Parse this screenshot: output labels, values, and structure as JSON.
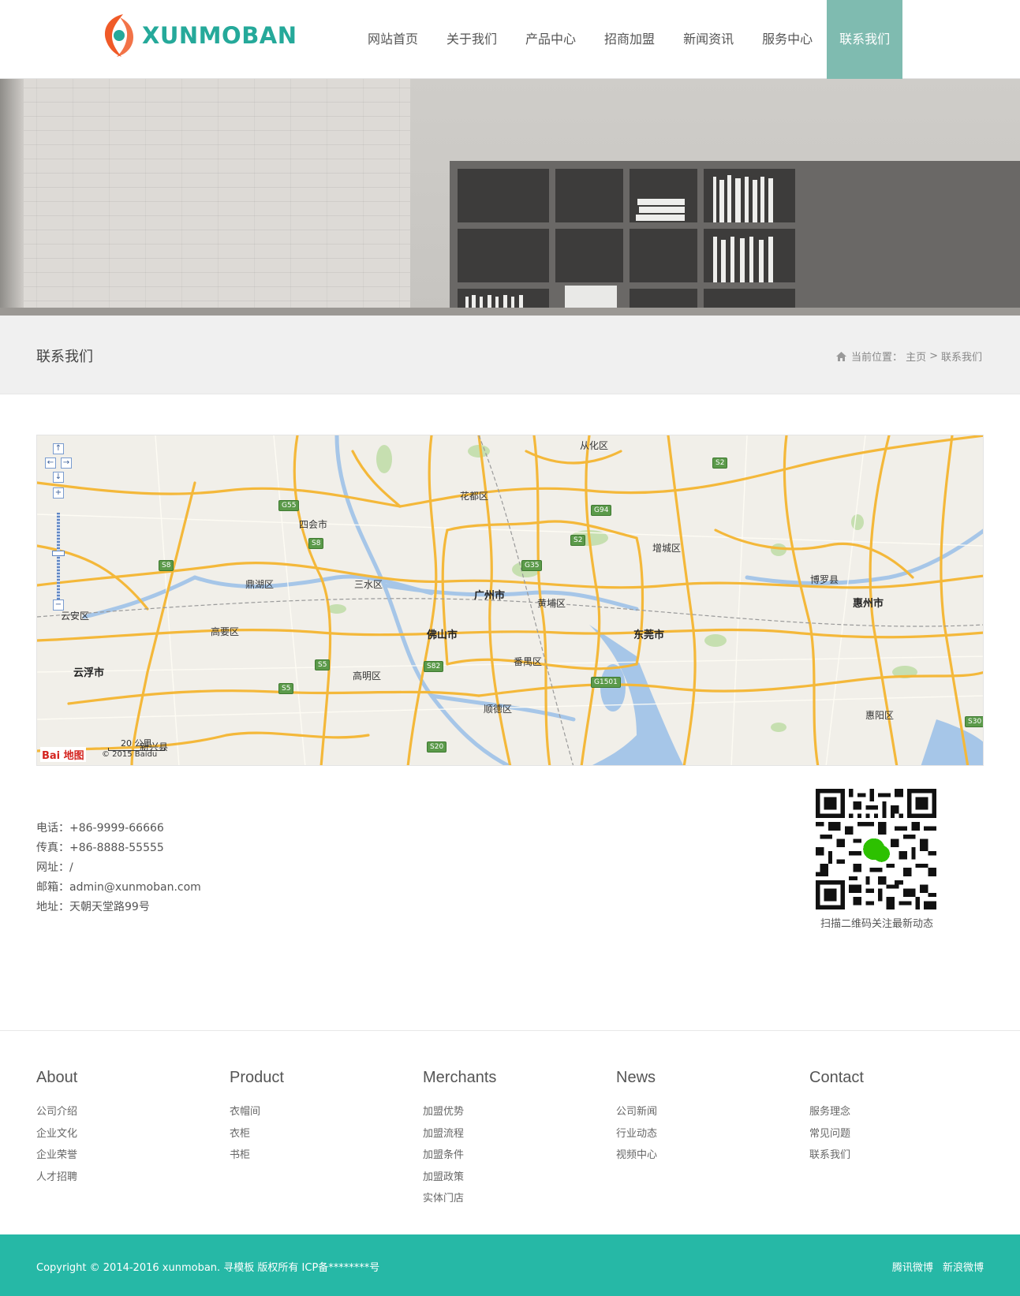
{
  "brand": {
    "logo_text": "XUNMOBAN",
    "accent": "#25a99a",
    "logo_orange": "#f05a28"
  },
  "nav": {
    "items": [
      {
        "label": "网站首页"
      },
      {
        "label": "关于我们"
      },
      {
        "label": "产品中心"
      },
      {
        "label": "招商加盟"
      },
      {
        "label": "新闻资讯"
      },
      {
        "label": "服务中心"
      },
      {
        "label": "联系我们"
      }
    ],
    "active_index": 6,
    "active_color": "#7fbbb0"
  },
  "page": {
    "title": "联系我们",
    "breadcrumb": {
      "prefix": "当前位置：",
      "home": "主页",
      "separator": ">",
      "current": "联系我们"
    }
  },
  "map": {
    "cities": [
      "广州市",
      "佛山市",
      "东莞市",
      "惠州市",
      "云浮市"
    ],
    "districts": [
      "从化区",
      "花都区",
      "四会市",
      "增城区",
      "鼎湖区",
      "三水区",
      "黄埔区",
      "博罗县",
      "云安区",
      "高要区",
      "番禺区",
      "高明区",
      "顺德区",
      "惠阳区",
      "新兴县"
    ],
    "highways": [
      "G55",
      "S8",
      "G94",
      "S2",
      "S2",
      "G35",
      "S8",
      "S5",
      "S82",
      "G1501",
      "S5",
      "S20",
      "S30"
    ],
    "scale_label": "20 公里",
    "provider_logo": "Bai 地图",
    "copyright": "© 2015 Baidu"
  },
  "contact": {
    "phone": "电话：+86-9999-66666",
    "fax": "传真：+86-8888-55555",
    "website": "网址：/",
    "email": "邮箱：admin@xunmoban.com",
    "address": "地址：天朝天堂路99号",
    "qr_caption": "扫描二维码关注最新动态"
  },
  "footer": {
    "columns": [
      {
        "title": "About",
        "links": [
          "公司介绍",
          "企业文化",
          "企业荣誉",
          "人才招聘"
        ]
      },
      {
        "title": "Product",
        "links": [
          "衣帽间",
          "衣柜",
          "书柜"
        ]
      },
      {
        "title": "Merchants",
        "links": [
          "加盟优势",
          "加盟流程",
          "加盟条件",
          "加盟政策",
          "实体门店"
        ]
      },
      {
        "title": "News",
        "links": [
          "公司新闻",
          "行业动态",
          "视频中心"
        ]
      },
      {
        "title": "Contact",
        "links": [
          "服务理念",
          "常见问题",
          "联系我们"
        ]
      }
    ],
    "copyright": "Copyright © 2014-2016 xunmoban. 寻模板 版权所有  ICP备********号",
    "social": [
      "腾讯微博",
      "新浪微博"
    ],
    "bar_color": "#26b8a6"
  }
}
